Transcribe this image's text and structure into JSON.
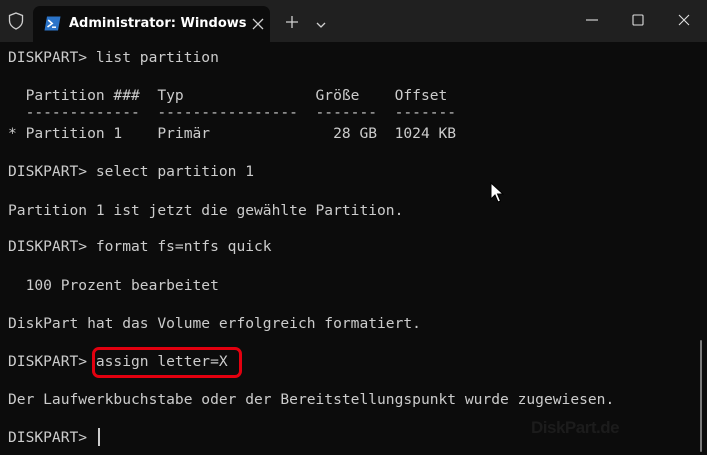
{
  "window": {
    "tab_title": "Administrator: Windows PowerShell",
    "icons": {
      "shield": "shield-icon",
      "tab": "powershell-icon",
      "tab_close": "close-icon",
      "new_tab": "plus-icon",
      "dropdown": "chevron-down-icon",
      "minimize": "minimize-icon",
      "maximize": "maximize-icon",
      "close": "close-icon"
    }
  },
  "terminal": {
    "lines": [
      "DISKPART> list partition",
      "",
      "  Partition ###  Typ               Größe    Offset",
      "  -------------  ----------------  -------  -------",
      "* Partition 1    Primär              28 GB  1024 KB",
      "",
      "DISKPART> select partition 1",
      "",
      "Partition 1 ist jetzt die gewählte Partition.",
      "",
      "DISKPART> format fs=ntfs quick",
      "",
      "  100 Prozent bearbeitet",
      "",
      "DiskPart hat das Volume erfolgreich formatiert.",
      "",
      "DISKPART> assign letter=X",
      "",
      "Der Laufwerkbuchstabe oder der Bereitstellungspunkt wurde zugewiesen.",
      "",
      "DISKPART> "
    ],
    "highlighted_command": "assign letter=X",
    "watermark": "DiskPart.de"
  },
  "colors": {
    "background": "#0c0c0c",
    "titlebar": "#202020",
    "text": "#cccccc",
    "highlight": "#e3000f"
  }
}
